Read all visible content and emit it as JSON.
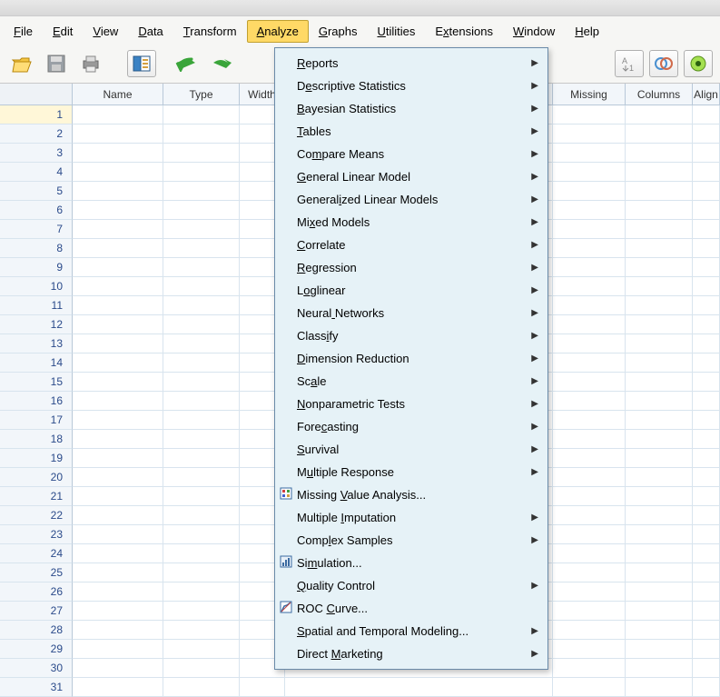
{
  "menu": {
    "file": "File",
    "edit": "Edit",
    "view": "View",
    "data": "Data",
    "transform": "Transform",
    "analyze": "Analyze",
    "graphs": "Graphs",
    "utilities": "Utilities",
    "extensions": "Extensions",
    "window": "Window",
    "help": "Help"
  },
  "columns": {
    "name": "Name",
    "type": "Type",
    "width": "Width",
    "missing": "Missing",
    "columns_": "Columns",
    "align": "Align"
  },
  "rows": [
    "1",
    "2",
    "3",
    "4",
    "5",
    "6",
    "7",
    "8",
    "9",
    "10",
    "11",
    "12",
    "13",
    "14",
    "15",
    "16",
    "17",
    "18",
    "19",
    "20",
    "21",
    "22",
    "23",
    "24",
    "25",
    "26",
    "27",
    "28",
    "29",
    "30",
    "31"
  ],
  "analyze_menu": [
    {
      "label": "Reports",
      "ul": 0,
      "arrow": true
    },
    {
      "label": "Descriptive Statistics",
      "ul": 1,
      "arrow": true
    },
    {
      "label": "Bayesian Statistics",
      "ul": 0,
      "arrow": true
    },
    {
      "label": "Tables",
      "ul": 0,
      "arrow": true
    },
    {
      "label": "Compare Means",
      "ul": 2,
      "arrow": true
    },
    {
      "label": "General Linear Model",
      "ul": 0,
      "arrow": true
    },
    {
      "label": "Generalized Linear Models",
      "ul": 7,
      "arrow": true
    },
    {
      "label": "Mixed Models",
      "ul": 2,
      "arrow": true
    },
    {
      "label": "Correlate",
      "ul": 0,
      "arrow": true
    },
    {
      "label": "Regression",
      "ul": 0,
      "arrow": true
    },
    {
      "label": "Loglinear",
      "ul": 1,
      "arrow": true
    },
    {
      "label": "Neural Networks",
      "ul": 6,
      "arrow": true
    },
    {
      "label": "Classify",
      "ul": 5,
      "arrow": true
    },
    {
      "label": "Dimension Reduction",
      "ul": 0,
      "arrow": true
    },
    {
      "label": "Scale",
      "ul": 2,
      "arrow": true
    },
    {
      "label": "Nonparametric Tests",
      "ul": 0,
      "arrow": true
    },
    {
      "label": "Forecasting",
      "ul": 4,
      "arrow": true
    },
    {
      "label": "Survival",
      "ul": 0,
      "arrow": true
    },
    {
      "label": "Multiple Response",
      "ul": 1,
      "arrow": true
    },
    {
      "label": "Missing Value Analysis...",
      "ul": 8,
      "arrow": false,
      "icon": "mva"
    },
    {
      "label": "Multiple Imputation",
      "ul": 9,
      "arrow": true
    },
    {
      "label": "Complex Samples",
      "ul": 4,
      "arrow": true
    },
    {
      "label": "Simulation...",
      "ul": 2,
      "arrow": false,
      "icon": "sim"
    },
    {
      "label": "Quality Control",
      "ul": 0,
      "arrow": true
    },
    {
      "label": "ROC Curve...",
      "ul": 4,
      "arrow": false,
      "icon": "roc"
    },
    {
      "label": "Spatial and Temporal Modeling...",
      "ul": 0,
      "arrow": true
    },
    {
      "label": "Direct Marketing",
      "ul": 7,
      "arrow": true
    }
  ],
  "icons": {
    "open": "open-icon",
    "save": "save-icon",
    "print": "print-icon",
    "recall": "recall-icon",
    "undo": "undo-icon",
    "redo": "redo-icon",
    "sort": "sort-icon",
    "venn": "venn-icon",
    "add": "add-icon"
  }
}
